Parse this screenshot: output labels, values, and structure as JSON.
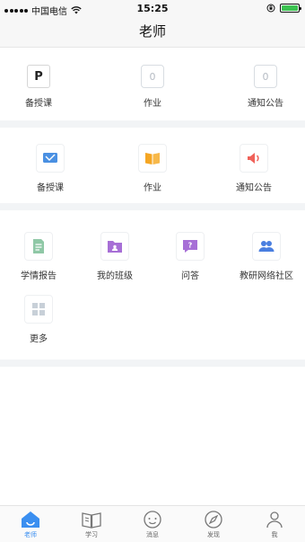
{
  "status_bar": {
    "carrier": "中国电信",
    "time": "15:25"
  },
  "nav": {
    "title": "老师"
  },
  "section1": {
    "items": [
      {
        "label": "备授课",
        "icon_char": "P"
      },
      {
        "label": "作业",
        "icon_char": "0"
      },
      {
        "label": "通知公告",
        "icon_char": "0"
      }
    ]
  },
  "section2": {
    "items": [
      {
        "label": "备授课",
        "icon": "monitor-icon"
      },
      {
        "label": "作业",
        "icon": "book-icon"
      },
      {
        "label": "通知公告",
        "icon": "speaker-icon"
      }
    ]
  },
  "section3": {
    "items": [
      {
        "label": "学情报告",
        "icon": "report-icon"
      },
      {
        "label": "我的班级",
        "icon": "class-folder-icon"
      },
      {
        "label": "问答",
        "icon": "question-icon"
      },
      {
        "label": "教研网络社区",
        "icon": "community-icon"
      },
      {
        "label": "更多",
        "icon": "grid-icon"
      }
    ]
  },
  "tabbar": {
    "tabs": [
      {
        "label": "老师",
        "icon": "home-icon",
        "active": true
      },
      {
        "label": "学习",
        "icon": "book-open-icon",
        "active": false
      },
      {
        "label": "消息",
        "icon": "chat-icon",
        "active": false
      },
      {
        "label": "发现",
        "icon": "compass-icon",
        "active": false
      },
      {
        "label": "我",
        "icon": "person-icon",
        "active": false
      }
    ]
  },
  "colors": {
    "accent": "#3b8ff0",
    "divider": "#f2f4f6",
    "battery": "#3cc251"
  }
}
